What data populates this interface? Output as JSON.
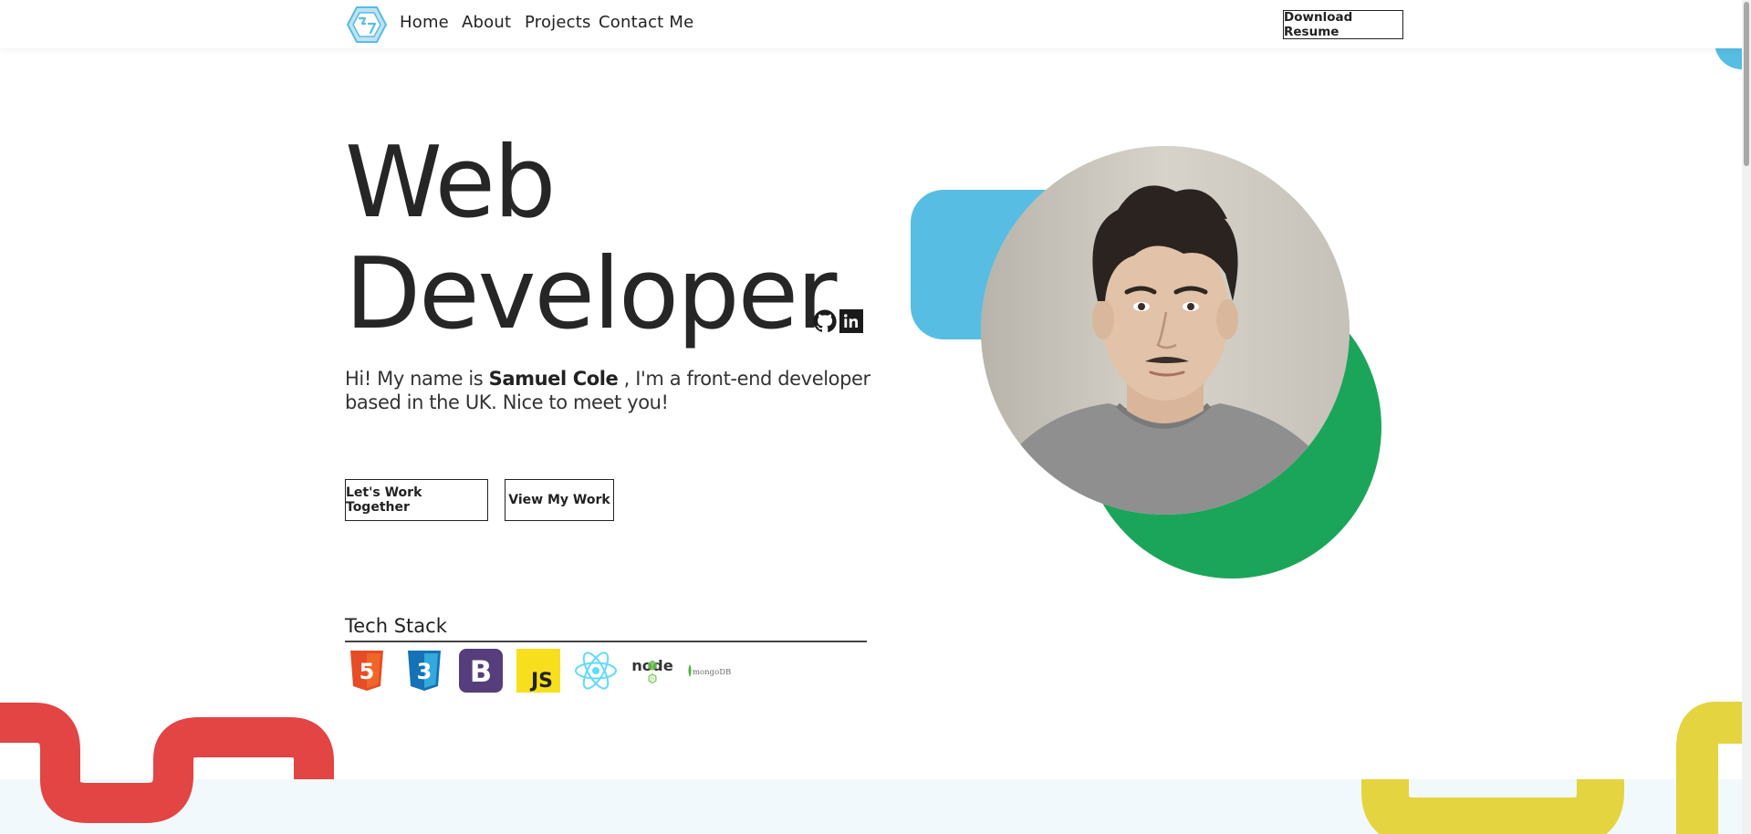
{
  "nav": {
    "logo_icon": "hexagon-logo-icon",
    "links": [
      "Home",
      "About",
      "Projects",
      "Contact Me"
    ],
    "resume_label": "Download Resume"
  },
  "hero": {
    "title_line1": "Web",
    "title_line2": "Developer",
    "intro_before": "Hi! My name is ",
    "intro_name": "Samuel Cole",
    "intro_after": " , I'm a front-end developer based in the UK. Nice to meet you!",
    "social": [
      "github-icon",
      "linkedin-icon"
    ],
    "cta_primary": "Let's Work Together",
    "cta_secondary": "View My Work",
    "portrait": "profile-photo"
  },
  "tech_stack": {
    "title": "Tech Stack",
    "items": [
      {
        "name": "html5-icon",
        "label": "5",
        "color": "#e44d26"
      },
      {
        "name": "css3-icon",
        "label": "3",
        "color": "#1572b6"
      },
      {
        "name": "bootstrap-icon",
        "label": "B",
        "color": "#563d7c"
      },
      {
        "name": "javascript-icon",
        "label": "JS",
        "color": "#f7df1e"
      },
      {
        "name": "react-icon",
        "label": "",
        "color": "#61dafb"
      },
      {
        "name": "nodejs-icon",
        "label": "node",
        "color": "#333333"
      },
      {
        "name": "mongodb-icon",
        "label": "mongoDB",
        "color": "#4db33d"
      }
    ]
  },
  "colors": {
    "accent_blue": "#57bde3",
    "accent_green": "#1ba55a",
    "accent_red": "#e34444",
    "accent_yellow": "#e4d43f"
  }
}
